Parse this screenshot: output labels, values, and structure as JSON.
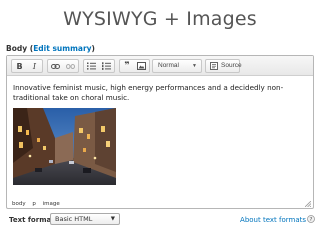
{
  "slide": {
    "title": "WYSIWYG + Images"
  },
  "field": {
    "label": "Body",
    "open_paren": " (",
    "edit_summary": "Edit summary",
    "close_paren": ")"
  },
  "toolbar": {
    "buttons": [
      {
        "name": "bold",
        "glyph": "B"
      },
      {
        "name": "italic",
        "glyph": "I"
      },
      {
        "name": "link",
        "icon": "link-icon"
      },
      {
        "name": "unlink",
        "icon": "unlink-icon"
      },
      {
        "name": "bulleted-list",
        "icon": "bulleted-list-icon"
      },
      {
        "name": "numbered-list",
        "icon": "numbered-list-icon"
      },
      {
        "name": "blockquote",
        "glyph": "❞"
      },
      {
        "name": "image",
        "icon": "image-icon"
      }
    ],
    "format_value": "Normal",
    "source_label": "Source"
  },
  "content": {
    "text": "Innovative feminist music, high energy performances and a decidedly non-traditional take on choral music."
  },
  "pathbar": {
    "items": [
      "body",
      "p",
      "image"
    ]
  },
  "text_format": {
    "label": "Text format",
    "selected": "Basic HTML",
    "about_link": "About text formats"
  },
  "colors": {
    "link": "#0074bd",
    "border": "#b6b6b6",
    "toolbar_bg": "#ececec"
  }
}
